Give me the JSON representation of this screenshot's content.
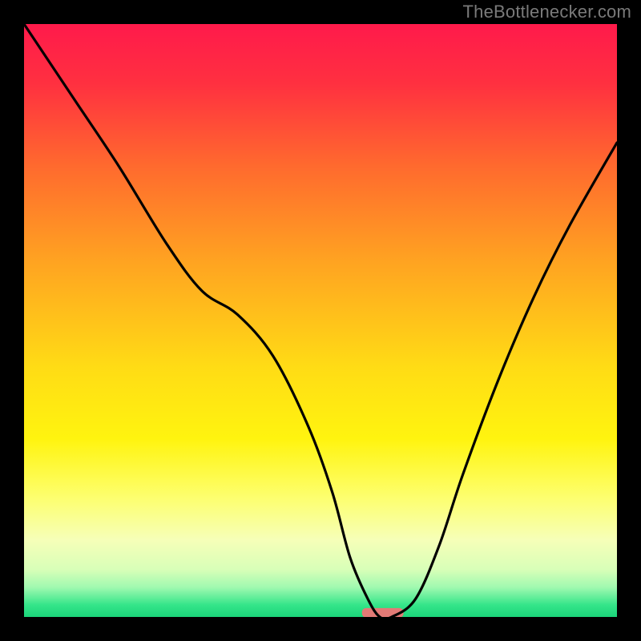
{
  "watermark": "TheBottlenecker.com",
  "chart_data": {
    "type": "line",
    "title": "",
    "xlabel": "",
    "ylabel": "",
    "xlim": [
      0,
      100
    ],
    "ylim": [
      0,
      100
    ],
    "grid": false,
    "background": {
      "stops": [
        {
          "offset": 0,
          "color": "#ff1a4b"
        },
        {
          "offset": 10,
          "color": "#ff3040"
        },
        {
          "offset": 24,
          "color": "#ff6a2e"
        },
        {
          "offset": 40,
          "color": "#ffa321"
        },
        {
          "offset": 58,
          "color": "#ffdc15"
        },
        {
          "offset": 70,
          "color": "#fff40f"
        },
        {
          "offset": 80,
          "color": "#fdff70"
        },
        {
          "offset": 87,
          "color": "#f6ffb8"
        },
        {
          "offset": 92,
          "color": "#d8ffb8"
        },
        {
          "offset": 95,
          "color": "#a0f9b0"
        },
        {
          "offset": 98,
          "color": "#34e589"
        },
        {
          "offset": 100,
          "color": "#1bd47a"
        }
      ]
    },
    "curve": {
      "x": [
        0,
        8,
        16,
        24,
        30,
        36,
        42,
        48,
        52,
        55,
        58,
        60,
        62,
        66,
        70,
        74,
        80,
        86,
        92,
        100
      ],
      "y": [
        100,
        88,
        76,
        63,
        55,
        51,
        44,
        32,
        21,
        10,
        3,
        0,
        0,
        3,
        12,
        24,
        40,
        54,
        66,
        80
      ]
    },
    "marker": {
      "x_start": 57,
      "x_end": 64,
      "y": 0.7,
      "color": "#e37a76",
      "height": 1.6
    }
  }
}
